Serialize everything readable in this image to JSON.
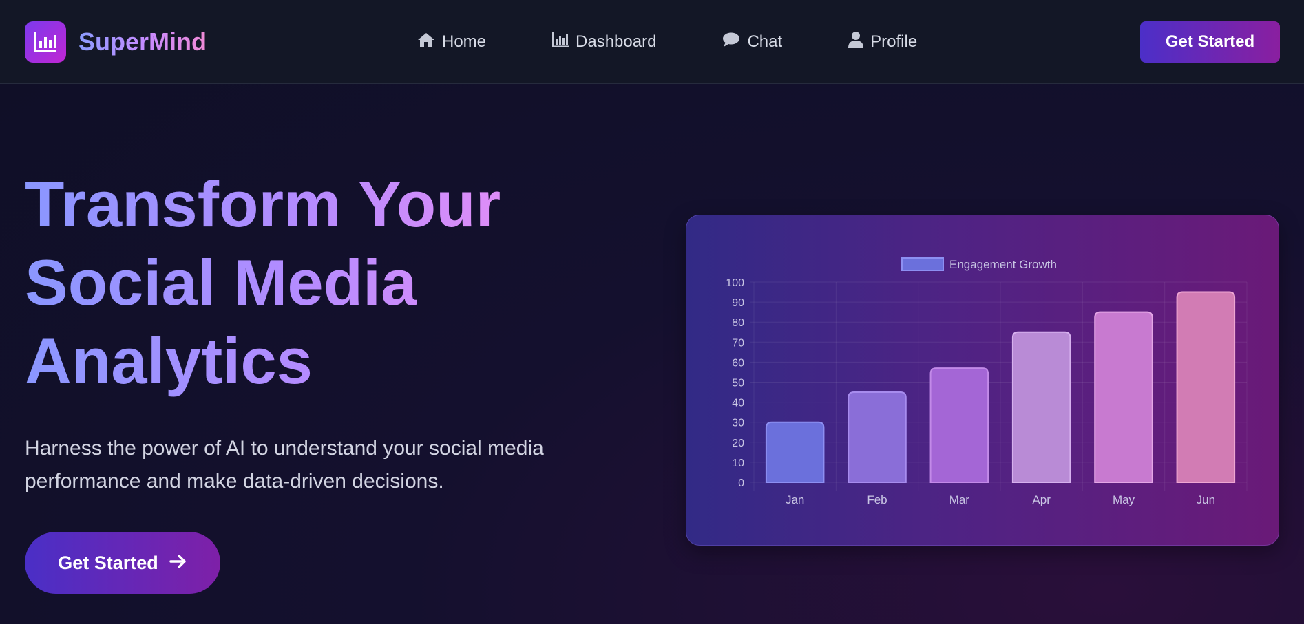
{
  "brand": {
    "name": "SuperMind",
    "logo_icon": "bar-chart-icon"
  },
  "nav": {
    "items": [
      {
        "label": "Home",
        "icon": "home-icon"
      },
      {
        "label": "Dashboard",
        "icon": "bar-chart-icon"
      },
      {
        "label": "Chat",
        "icon": "chat-bubble-icon"
      },
      {
        "label": "Profile",
        "icon": "user-icon"
      }
    ],
    "cta_label": "Get Started"
  },
  "hero": {
    "title_lines": [
      "Transform Your",
      "Social Media",
      "Analytics"
    ],
    "subtitle_lines": [
      "Harness the power of AI to understand your social media",
      "performance and make data-driven decisions."
    ],
    "cta_label": "Get Started",
    "cta_icon": "arrow-right-icon"
  },
  "colors": {
    "accent_start": "#4c2fc8",
    "accent_end": "#8a1fa0",
    "card_start": "#322a86",
    "card_end": "#6a1a78"
  },
  "chart_data": {
    "type": "bar",
    "categories": [
      "Jan",
      "Feb",
      "Mar",
      "Apr",
      "May",
      "Jun"
    ],
    "series": [
      {
        "name": "Engagement Growth",
        "values": [
          30,
          45,
          57,
          75,
          85,
          95
        ]
      }
    ],
    "ylim": [
      0,
      100
    ],
    "yticks": [
      0,
      10,
      20,
      30,
      40,
      50,
      60,
      70,
      80,
      90,
      100
    ],
    "grid": true,
    "legend_position": "top-center",
    "bar_colors": [
      "#6b70dc",
      "#8a6ed8",
      "#a466d6",
      "#b98bd6",
      "#c87ad0",
      "#d27cb4"
    ],
    "bar_borders": [
      "#8d8ff2",
      "#a78cee",
      "#c28ae8",
      "#d6b0ee",
      "#e4a6e6",
      "#eea6d2"
    ]
  }
}
